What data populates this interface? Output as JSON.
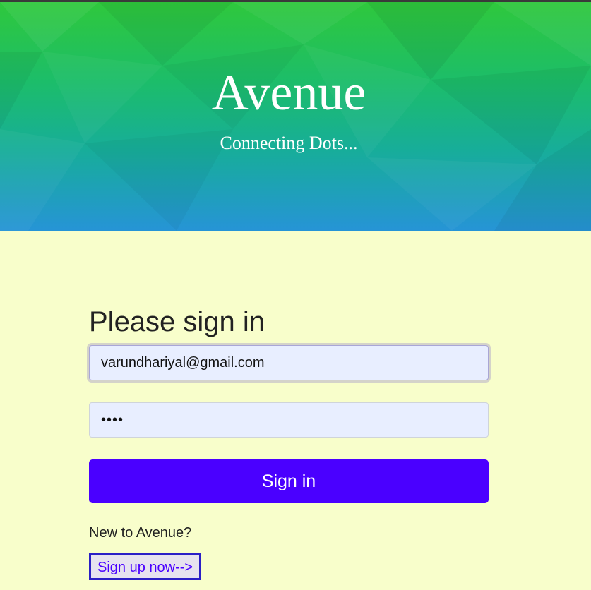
{
  "hero": {
    "title": "Avenue",
    "subtitle": "Connecting Dots..."
  },
  "signin": {
    "heading": "Please sign in",
    "email_value": "varundhariyal@gmail.com",
    "password_value": "••••",
    "submit_label": "Sign in",
    "new_user_text": "New to Avenue?",
    "signup_link_label": "Sign up now-->"
  },
  "colors": {
    "background": "#f8fecb",
    "accent": "#4a00ff",
    "hero_top": "#2fc83c",
    "hero_bottom": "#2694d6"
  }
}
